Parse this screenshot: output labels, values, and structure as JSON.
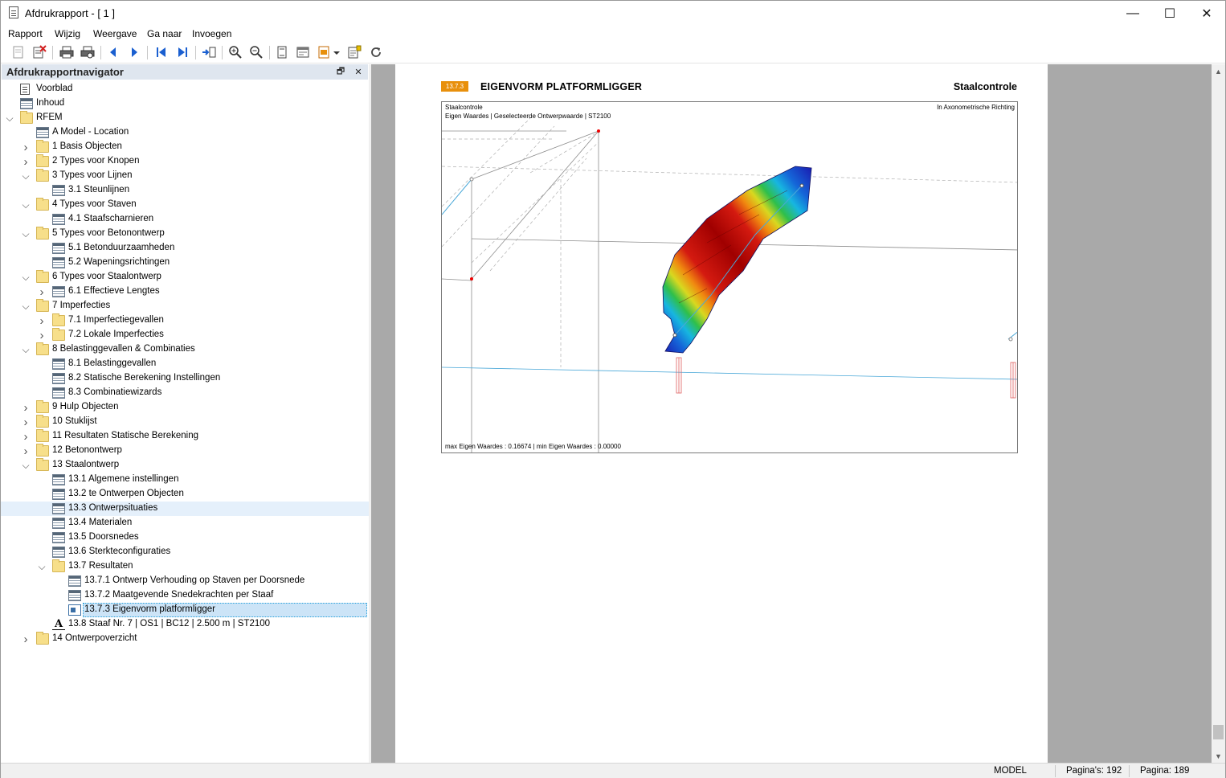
{
  "window": {
    "title": "Afdrukrapport - [ 1 ]",
    "controls": {
      "minimize": "—",
      "maximize": "☐",
      "close": "✕"
    }
  },
  "menu": [
    "Rapport",
    "Wijzig",
    "Weergave",
    "Ga naar",
    "Invoegen"
  ],
  "toolbar": {
    "icons": [
      "new-report-icon",
      "delete-report-icon",
      "print-icon",
      "print-preview-icon",
      "previous-page-icon",
      "next-page-icon",
      "first-page-icon",
      "last-page-icon",
      "goto-page-icon",
      "zoom-in-icon",
      "zoom-out-icon",
      "fit-page-icon",
      "page-setup-icon",
      "export-icon",
      "dropdown-icon",
      "properties-icon",
      "refresh-icon"
    ]
  },
  "navigator": {
    "title": "Afdrukrapportnavigator",
    "pin": "🗗",
    "close": "✕",
    "items": [
      {
        "label": "Voorblad",
        "icon": "page",
        "level": 0,
        "chev": ""
      },
      {
        "label": "Inhoud",
        "icon": "table",
        "level": 0,
        "chev": ""
      },
      {
        "label": "RFEM",
        "icon": "folder",
        "level": 0,
        "chev": "down"
      },
      {
        "label": "A Model - Location",
        "icon": "table",
        "level": 1,
        "chev": ""
      },
      {
        "label": "1 Basis Objecten",
        "icon": "folder",
        "level": 1,
        "chev": "right"
      },
      {
        "label": "2 Types voor Knopen",
        "icon": "folder",
        "level": 1,
        "chev": "right"
      },
      {
        "label": "3 Types voor Lijnen",
        "icon": "folder",
        "level": 1,
        "chev": "down"
      },
      {
        "label": "3.1 Steunlijnen",
        "icon": "table",
        "level": 2,
        "chev": ""
      },
      {
        "label": "4 Types voor Staven",
        "icon": "folder",
        "level": 1,
        "chev": "down"
      },
      {
        "label": "4.1 Staafscharnieren",
        "icon": "table",
        "level": 2,
        "chev": ""
      },
      {
        "label": "5 Types voor Betonontwerp",
        "icon": "folder",
        "level": 1,
        "chev": "down"
      },
      {
        "label": "5.1 Betonduurzaamheden",
        "icon": "table",
        "level": 2,
        "chev": ""
      },
      {
        "label": "5.2 Wapeningsrichtingen",
        "icon": "table",
        "level": 2,
        "chev": ""
      },
      {
        "label": "6 Types voor Staalontwerp",
        "icon": "folder",
        "level": 1,
        "chev": "down"
      },
      {
        "label": "6.1 Effectieve Lengtes",
        "icon": "table",
        "level": 2,
        "chev": "right"
      },
      {
        "label": "7 Imperfecties",
        "icon": "folder",
        "level": 1,
        "chev": "down"
      },
      {
        "label": "7.1 Imperfectiegevallen",
        "icon": "folder",
        "level": 2,
        "chev": "right"
      },
      {
        "label": "7.2 Lokale Imperfecties",
        "icon": "folder",
        "level": 2,
        "chev": "right"
      },
      {
        "label": "8 Belastinggevallen & Combinaties",
        "icon": "folder",
        "level": 1,
        "chev": "down"
      },
      {
        "label": "8.1 Belastinggevallen",
        "icon": "table",
        "level": 2,
        "chev": ""
      },
      {
        "label": "8.2 Statische Berekening Instellingen",
        "icon": "table",
        "level": 2,
        "chev": ""
      },
      {
        "label": "8.3 Combinatiewizards",
        "icon": "table",
        "level": 2,
        "chev": ""
      },
      {
        "label": "9 Hulp Objecten",
        "icon": "folder",
        "level": 1,
        "chev": "right"
      },
      {
        "label": "10 Stuklijst",
        "icon": "folder",
        "level": 1,
        "chev": "right"
      },
      {
        "label": "11 Resultaten Statische Berekening",
        "icon": "folder",
        "level": 1,
        "chev": "right"
      },
      {
        "label": "12 Betonontwerp",
        "icon": "folder",
        "level": 1,
        "chev": "right"
      },
      {
        "label": "13 Staalontwerp",
        "icon": "folder",
        "level": 1,
        "chev": "down"
      },
      {
        "label": "13.1 Algemene instellingen",
        "icon": "table",
        "level": 2,
        "chev": ""
      },
      {
        "label": "13.2 te Ontwerpen Objecten",
        "icon": "table",
        "level": 2,
        "chev": ""
      },
      {
        "label": "13.3 Ontwerpsituaties",
        "icon": "table",
        "level": 2,
        "chev": "",
        "state": "hover"
      },
      {
        "label": "13.4 Materialen",
        "icon": "table",
        "level": 2,
        "chev": ""
      },
      {
        "label": "13.5 Doorsnedes",
        "icon": "table",
        "level": 2,
        "chev": ""
      },
      {
        "label": "13.6 Sterkteconfiguraties",
        "icon": "table",
        "level": 2,
        "chev": ""
      },
      {
        "label": "13.7 Resultaten",
        "icon": "folder",
        "level": 2,
        "chev": "down"
      },
      {
        "label": "13.7.1 Ontwerp Verhouding op Staven per Doorsnede",
        "icon": "table",
        "level": 3,
        "chev": ""
      },
      {
        "label": "13.7.2 Maatgevende Snedekrachten per Staaf",
        "icon": "table",
        "level": 3,
        "chev": ""
      },
      {
        "label": "13.7.3 Eigenvorm platformligger",
        "icon": "image",
        "level": 3,
        "chev": "",
        "state": "selected"
      },
      {
        "label": "13.8 Staaf Nr. 7 | OS1 | BC12 | 2.500 m | ST2100",
        "icon": "text",
        "level": 2,
        "chev": ""
      },
      {
        "label": "14 Ontwerpoverzicht",
        "icon": "folder",
        "level": 1,
        "chev": "right"
      }
    ]
  },
  "page": {
    "section_number": "13.7.3",
    "section_title": "EIGENVORM PLATFORMLIGGER",
    "header_right": "Staalcontrole",
    "figure": {
      "caption_line1": "Staalcontrole",
      "caption_line2": "Eigen Waardes | Geselecteerde Ontwerpwaarde | ST2100",
      "caption_right": "In Axonometrische Richting",
      "footer": "max Eigen Waardes : 0.16674 | min Eigen Waardes : 0.00000"
    }
  },
  "status": {
    "mode": "MODEL",
    "pages_total": "Pagina's: 192",
    "page_current": "Pagina: 189"
  },
  "colors": {
    "accent": "#e8900c",
    "nav_header": "#dfe6ef",
    "selection": "#cce4f7",
    "doc_background": "#a9a9a9"
  }
}
